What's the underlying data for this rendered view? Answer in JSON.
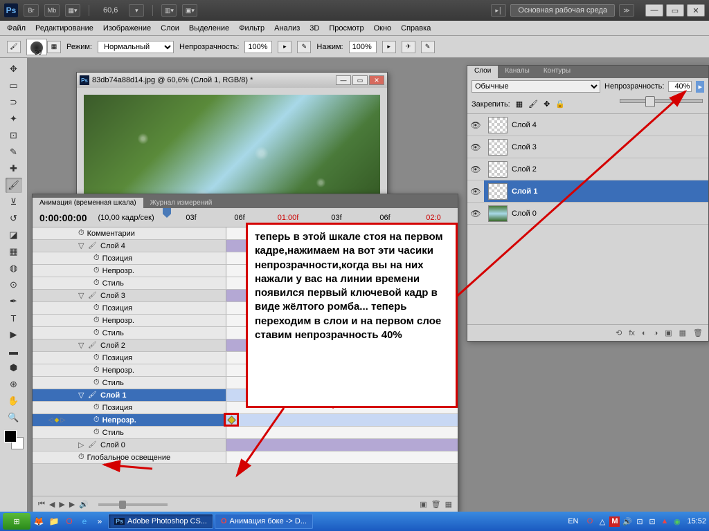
{
  "titlebar": {
    "zoom": "60,6",
    "workspace_label": "Основная рабочая среда"
  },
  "menu": {
    "file": "Файл",
    "edit": "Редактирование",
    "image": "Изображение",
    "layer": "Слои",
    "select": "Выделение",
    "filter": "Фильтр",
    "analysis": "Анализ",
    "threed": "3D",
    "view": "Просмотр",
    "window": "Окно",
    "help": "Справка"
  },
  "options": {
    "brush_size": "30",
    "mode_label": "Режим:",
    "mode_value": "Нормальный",
    "opacity_label": "Непрозрачность:",
    "opacity_value": "100%",
    "flow_label": "Нажим:",
    "flow_value": "100%"
  },
  "document": {
    "title": "83db74a88d14.jpg @ 60,6% (Слой 1, RGB/8) *"
  },
  "timeline": {
    "tab_anim": "Анимация (временная шкала)",
    "tab_log": "Журнал измерений",
    "timecode": "0:00:00:00",
    "fps": "(10,00 кадр/сек)",
    "ruler": [
      "03f",
      "06f",
      "01:00f",
      "03f",
      "06f",
      "02:0"
    ],
    "comments": "Комментарии",
    "layers": [
      {
        "name": "Слой 4",
        "props": [
          "Позиция",
          "Непрозр.",
          "Стиль"
        ]
      },
      {
        "name": "Слой 3",
        "props": [
          "Позиция",
          "Непрозр.",
          "Стиль"
        ]
      },
      {
        "name": "Слой 2",
        "props": [
          "Позиция",
          "Непрозр.",
          "Стиль"
        ]
      },
      {
        "name": "Слой 1",
        "props": [
          "Позиция",
          "Непрозр.",
          "Стиль"
        ],
        "selected_prop": 1
      },
      {
        "name": "Слой 0"
      }
    ],
    "global": "Глобальное освещение"
  },
  "layers_panel": {
    "tab_layers": "Слои",
    "tab_channels": "Каналы",
    "tab_paths": "Контуры",
    "blend_mode": "Обычные",
    "opacity_label": "Непрозрачность:",
    "opacity_value": "40%",
    "lock_label": "Закрепить:",
    "layers": [
      {
        "name": "Слой 4"
      },
      {
        "name": "Слой 3"
      },
      {
        "name": "Слой 2"
      },
      {
        "name": "Слой 1",
        "selected": true
      },
      {
        "name": "Слой 0",
        "img": true
      }
    ]
  },
  "annotation": "теперь в этой шкале стоя на первом кадре,нажимаем на вот эти часики непрозрачности,когда вы на них нажали у вас на линии времени появился первый ключевой кадр в виде жёлтого ромба... теперь переходим в слои и на первом слое ставим непрозрачность  40%",
  "taskbar": {
    "task1": "Adobe Photoshop CS...",
    "task2": "Анимация боке -> D...",
    "lang": "EN",
    "time": "15:52"
  }
}
